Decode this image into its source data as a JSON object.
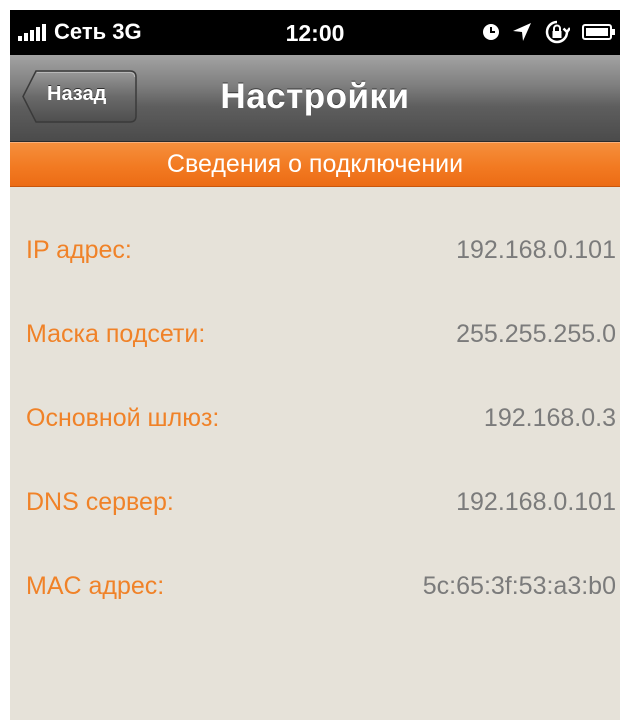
{
  "status_bar": {
    "carrier": "Сеть 3G",
    "time": "12:00",
    "icons": [
      "signal-bars-icon",
      "clock-icon",
      "location-arrow-icon",
      "rotation-lock-icon",
      "battery-icon"
    ]
  },
  "nav": {
    "back_label": "Назад",
    "title": "Настройки"
  },
  "section": {
    "title": "Сведения о подключении"
  },
  "rows": [
    {
      "label": "IP адрес:",
      "value": "192.168.0.101"
    },
    {
      "label": "Маска подсети:",
      "value": "255.255.255.0"
    },
    {
      "label": "Основной шлюз:",
      "value": "192.168.0.3"
    },
    {
      "label": "DNS сервер:",
      "value": "192.168.0.101"
    },
    {
      "label": "MAC адрес:",
      "value": "5c:65:3f:53:a3:b0"
    }
  ],
  "colors": {
    "accent_orange": "#f27a22",
    "label_orange": "#f08228",
    "value_gray": "#7b7b7b",
    "background": "#e6e2d9"
  }
}
